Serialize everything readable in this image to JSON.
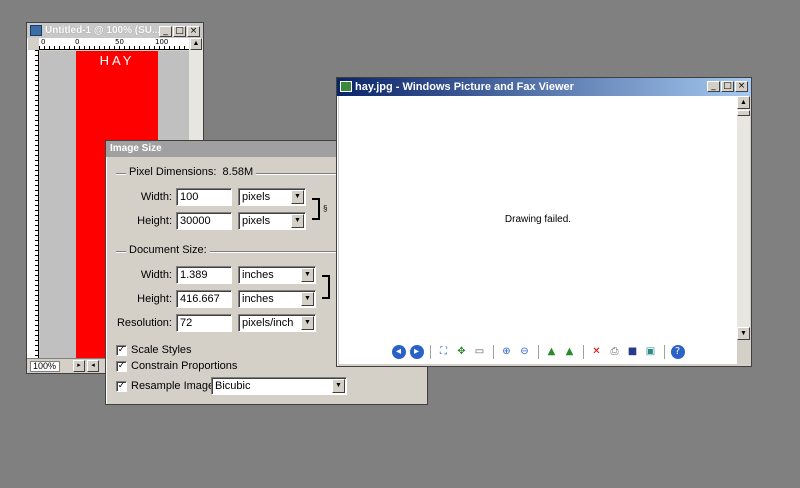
{
  "psdoc": {
    "title": "Untitled-1 @ 100% (SU...",
    "image_text": "HAY",
    "ruler_labels": [
      "0",
      "0",
      "50",
      "100"
    ],
    "zoom": "100%"
  },
  "image_size": {
    "title": "Image Size",
    "pixel_dimensions_label": "Pixel Dimensions:",
    "pixel_dimensions_value": "8.58M",
    "width_label": "Width:",
    "width_px": "100",
    "width_px_unit": "pixels",
    "height_label": "Height:",
    "height_px": "30000",
    "height_px_unit": "pixels",
    "document_size_label": "Document Size:",
    "doc_width": "1.389",
    "doc_width_unit": "inches",
    "doc_height": "416.667",
    "doc_height_unit": "inches",
    "resolution_label": "Resolution:",
    "resolution": "72",
    "resolution_unit": "pixels/inch",
    "scale_styles": "Scale Styles",
    "constrain": "Constrain Proportions",
    "resample_label": "Resample Image:",
    "resample_value": "Bicubic"
  },
  "viewer": {
    "title": "hay.jpg - Windows Picture and Fax Viewer",
    "message": "Drawing failed."
  },
  "toolbar_icons": [
    "previous-icon",
    "next-icon",
    "best-fit-icon",
    "actual-size-icon",
    "slideshow-icon",
    "zoom-in-icon",
    "zoom-out-icon",
    "rotate-clockwise-icon",
    "rotate-counterclockwise-icon",
    "delete-icon",
    "print-icon",
    "save-icon",
    "edit-icon",
    "help-icon"
  ]
}
